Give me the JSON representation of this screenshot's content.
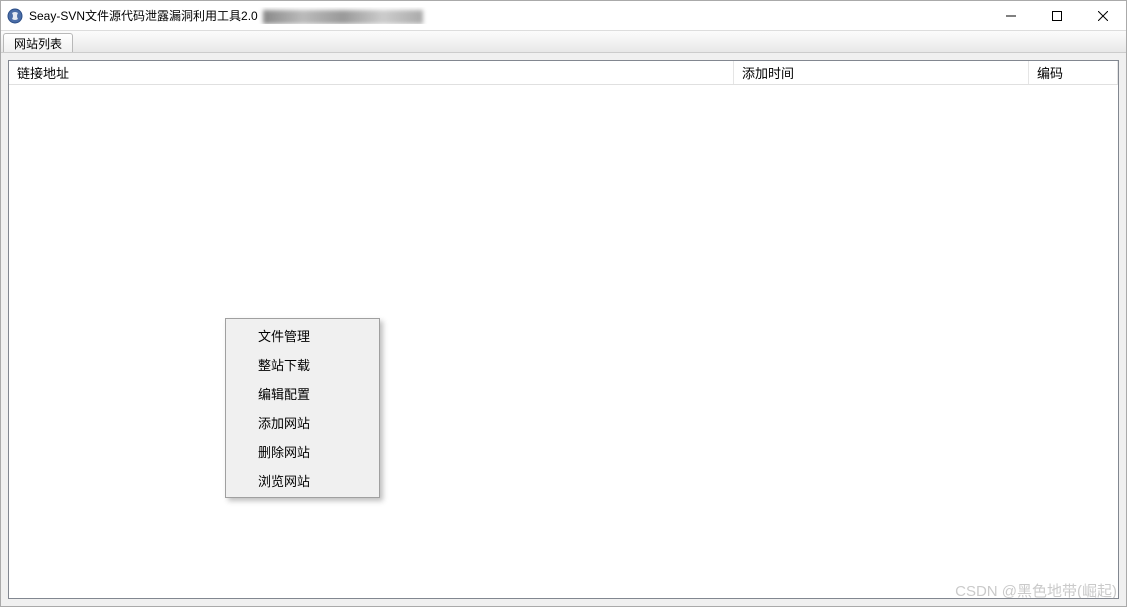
{
  "titlebar": {
    "app_title": "Seay-SVN文件源代码泄露漏洞利用工具2.0"
  },
  "tabs": {
    "website_list": "网站列表"
  },
  "list": {
    "columns": {
      "url": "链接地址",
      "add_time": "添加时间",
      "encoding": "编码"
    },
    "rows": []
  },
  "context_menu": {
    "items": [
      {
        "label": "文件管理"
      },
      {
        "label": "整站下载"
      },
      {
        "label": "编辑配置"
      },
      {
        "label": "添加网站"
      },
      {
        "label": "删除网站"
      },
      {
        "label": "浏览网站"
      }
    ]
  },
  "watermark": "CSDN @黑色地带(崛起)"
}
